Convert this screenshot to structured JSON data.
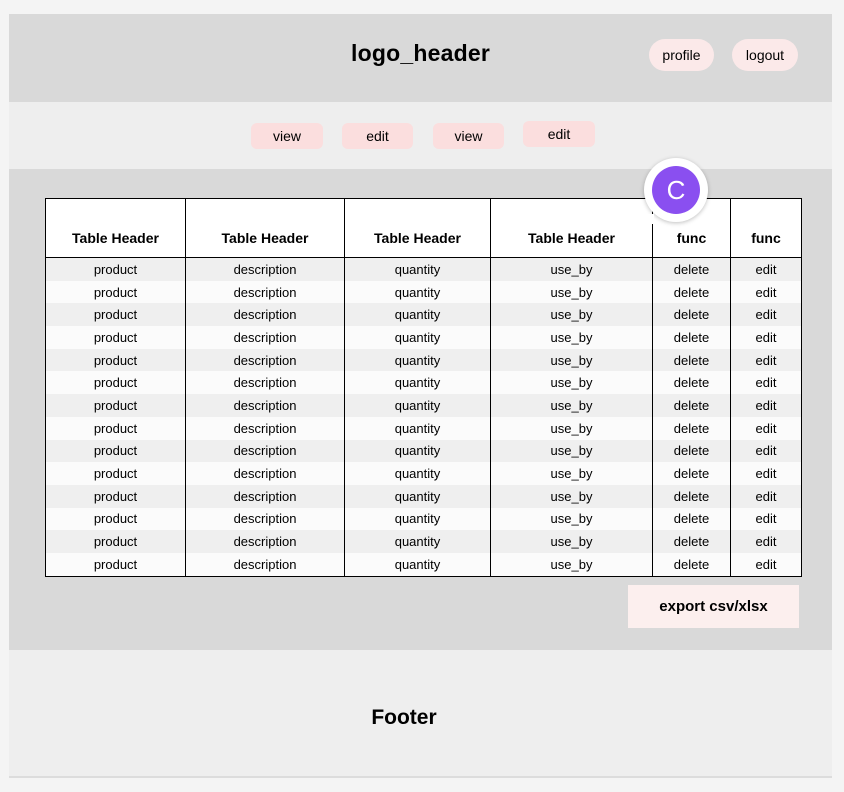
{
  "header": {
    "logo": "logo_header",
    "profile_label": "profile",
    "logout_label": "logout"
  },
  "nav": {
    "buttons": [
      "view",
      "edit",
      "view",
      "edit"
    ]
  },
  "table": {
    "headers": [
      "Table Header",
      "Table Header",
      "Table Header",
      "Table Header",
      "func",
      "func"
    ],
    "rows": [
      [
        "product",
        "description",
        "quantity",
        "use_by",
        "delete",
        "edit"
      ],
      [
        "product",
        "description",
        "quantity",
        "use_by",
        "delete",
        "edit"
      ],
      [
        "product",
        "description",
        "quantity",
        "use_by",
        "delete",
        "edit"
      ],
      [
        "product",
        "description",
        "quantity",
        "use_by",
        "delete",
        "edit"
      ],
      [
        "product",
        "description",
        "quantity",
        "use_by",
        "delete",
        "edit"
      ],
      [
        "product",
        "description",
        "quantity",
        "use_by",
        "delete",
        "edit"
      ],
      [
        "product",
        "description",
        "quantity",
        "use_by",
        "delete",
        "edit"
      ],
      [
        "product",
        "description",
        "quantity",
        "use_by",
        "delete",
        "edit"
      ],
      [
        "product",
        "description",
        "quantity",
        "use_by",
        "delete",
        "edit"
      ],
      [
        "product",
        "description",
        "quantity",
        "use_by",
        "delete",
        "edit"
      ],
      [
        "product",
        "description",
        "quantity",
        "use_by",
        "delete",
        "edit"
      ],
      [
        "product",
        "description",
        "quantity",
        "use_by",
        "delete",
        "edit"
      ],
      [
        "product",
        "description",
        "quantity",
        "use_by",
        "delete",
        "edit"
      ],
      [
        "product",
        "description",
        "quantity",
        "use_by",
        "delete",
        "edit"
      ]
    ]
  },
  "avatar": {
    "initial": "C",
    "color": "#8a4ff0"
  },
  "export_label": "export csv/xlsx",
  "footer": {
    "text": "Footer"
  },
  "colors": {
    "header_bg": "#d9d9d9",
    "nav_bg": "#eeeeee",
    "pill_bg": "#fbe9e9",
    "nav_button_bg": "#fbdede",
    "export_bg": "#fcefee"
  }
}
